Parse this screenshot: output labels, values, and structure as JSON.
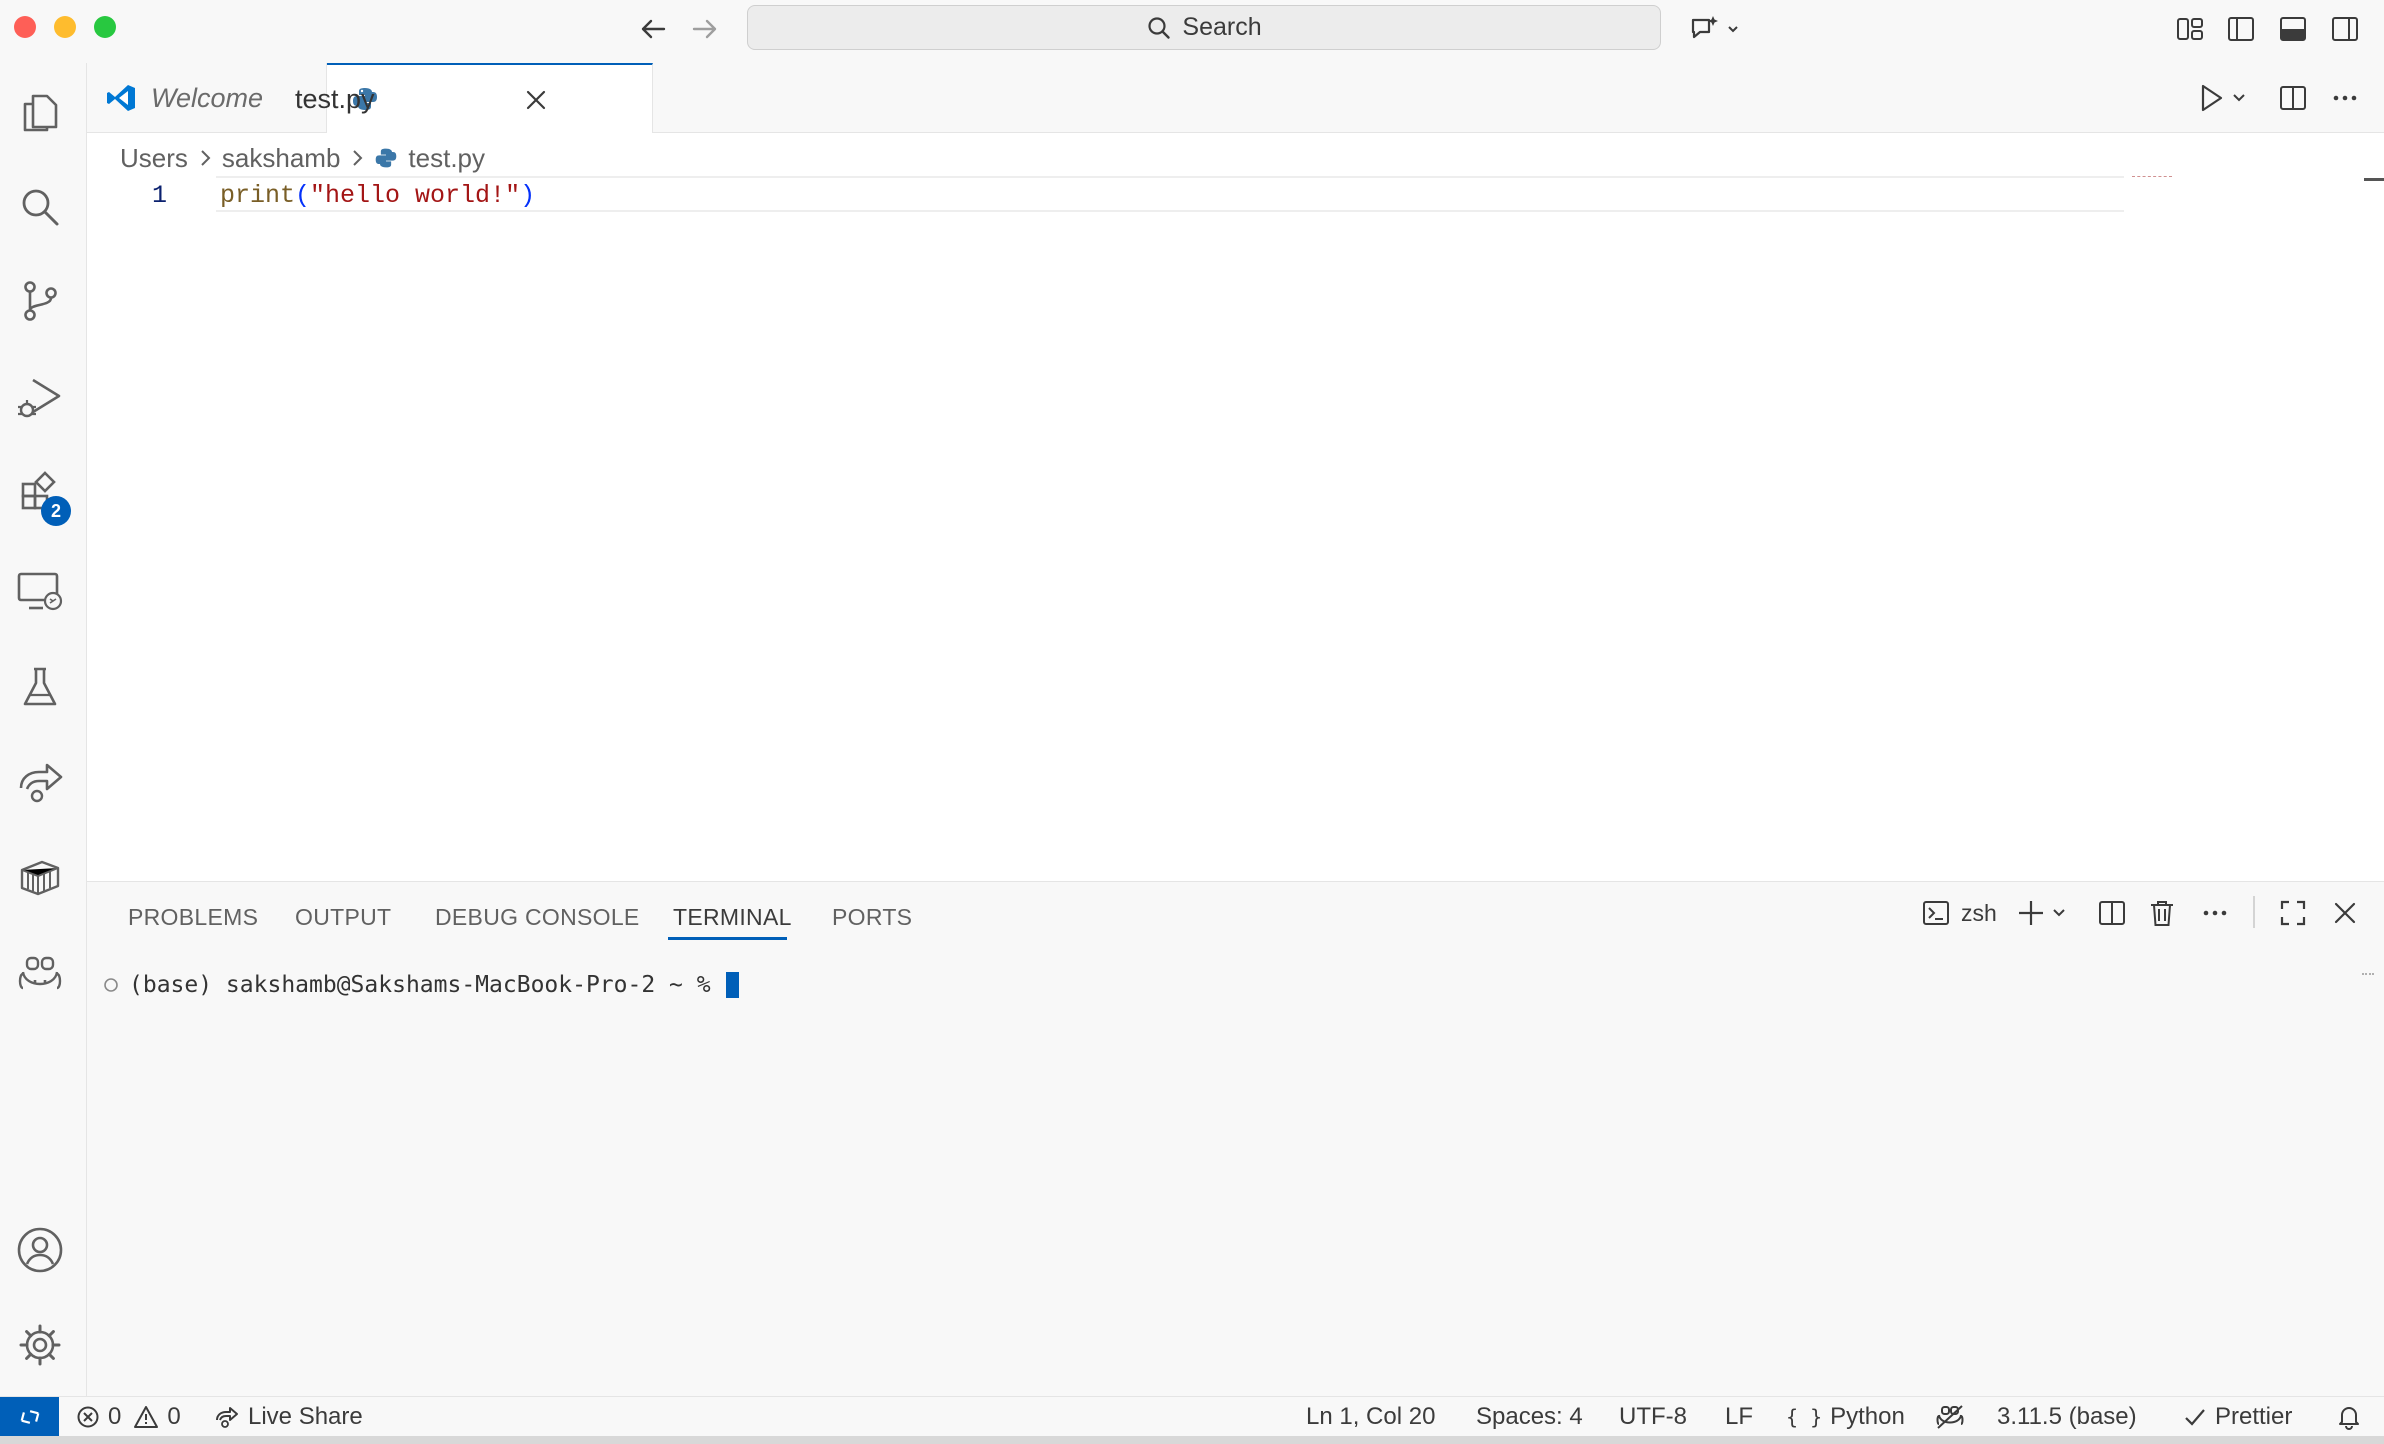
{
  "titlebar": {
    "search_label": "Search"
  },
  "activity_bar": {
    "extensions_badge": "2"
  },
  "tabs": [
    {
      "label": "Welcome"
    },
    {
      "label": "test.py"
    }
  ],
  "breadcrumb": [
    "Users",
    "sakshamb",
    "test.py"
  ],
  "editor": {
    "line_number": "1",
    "code": {
      "func": "print",
      "open": "(",
      "string": "\"hello world!\"",
      "close": ")"
    }
  },
  "panel": {
    "tabs": [
      "PROBLEMS",
      "OUTPUT",
      "DEBUG CONSOLE",
      "TERMINAL",
      "PORTS"
    ],
    "active_tab": "TERMINAL",
    "shell_name": "zsh",
    "terminal_prompt": "(base) sakshamb@Sakshams-MacBook-Pro-2 ~ % "
  },
  "status_bar": {
    "errors": "0",
    "warnings": "0",
    "live_share": "Live Share",
    "cursor_position": "Ln 1, Col 20",
    "spaces": "Spaces: 4",
    "encoding": "UTF-8",
    "eol": "LF",
    "language": "Python",
    "interpreter": "3.11.5 (base)",
    "prettier": "Prettier"
  },
  "colors": {
    "accent": "#005fb8",
    "string": "#a31515",
    "function": "#795e26",
    "line_number": "#0b216f"
  }
}
